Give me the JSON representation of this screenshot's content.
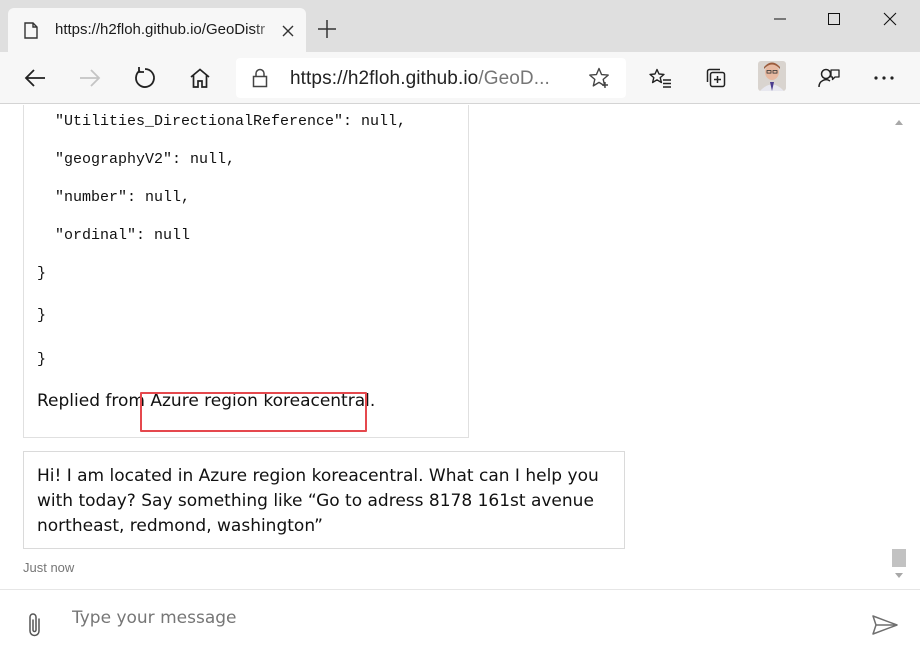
{
  "tab": {
    "title": "https://h2floh.github.io/GeoDistr"
  },
  "address_bar": {
    "host": "https://h2floh.github.io",
    "path": "/GeoD..."
  },
  "code_lines": [
    "\"Utilities_DirectionalReference\": null,",
    "\"geographyV2\": null,",
    "\"number\": null,",
    "\"ordinal\": null",
    "}",
    "}",
    "}"
  ],
  "reply": {
    "prefix": "Replied from ",
    "region": "Azure region koreacentral."
  },
  "greeting": {
    "text": "Hi! I am located in Azure region koreacentral. What can I help you with today? Say something like “Go to adress 8178 161st avenue northeast, redmond, washington”"
  },
  "timestamp": "Just now",
  "input": {
    "placeholder": "Type your message"
  },
  "colors": {
    "highlight": "#e5484d",
    "tab_bar": "#dfdfdf",
    "toolbar": "#f7f7f7"
  }
}
